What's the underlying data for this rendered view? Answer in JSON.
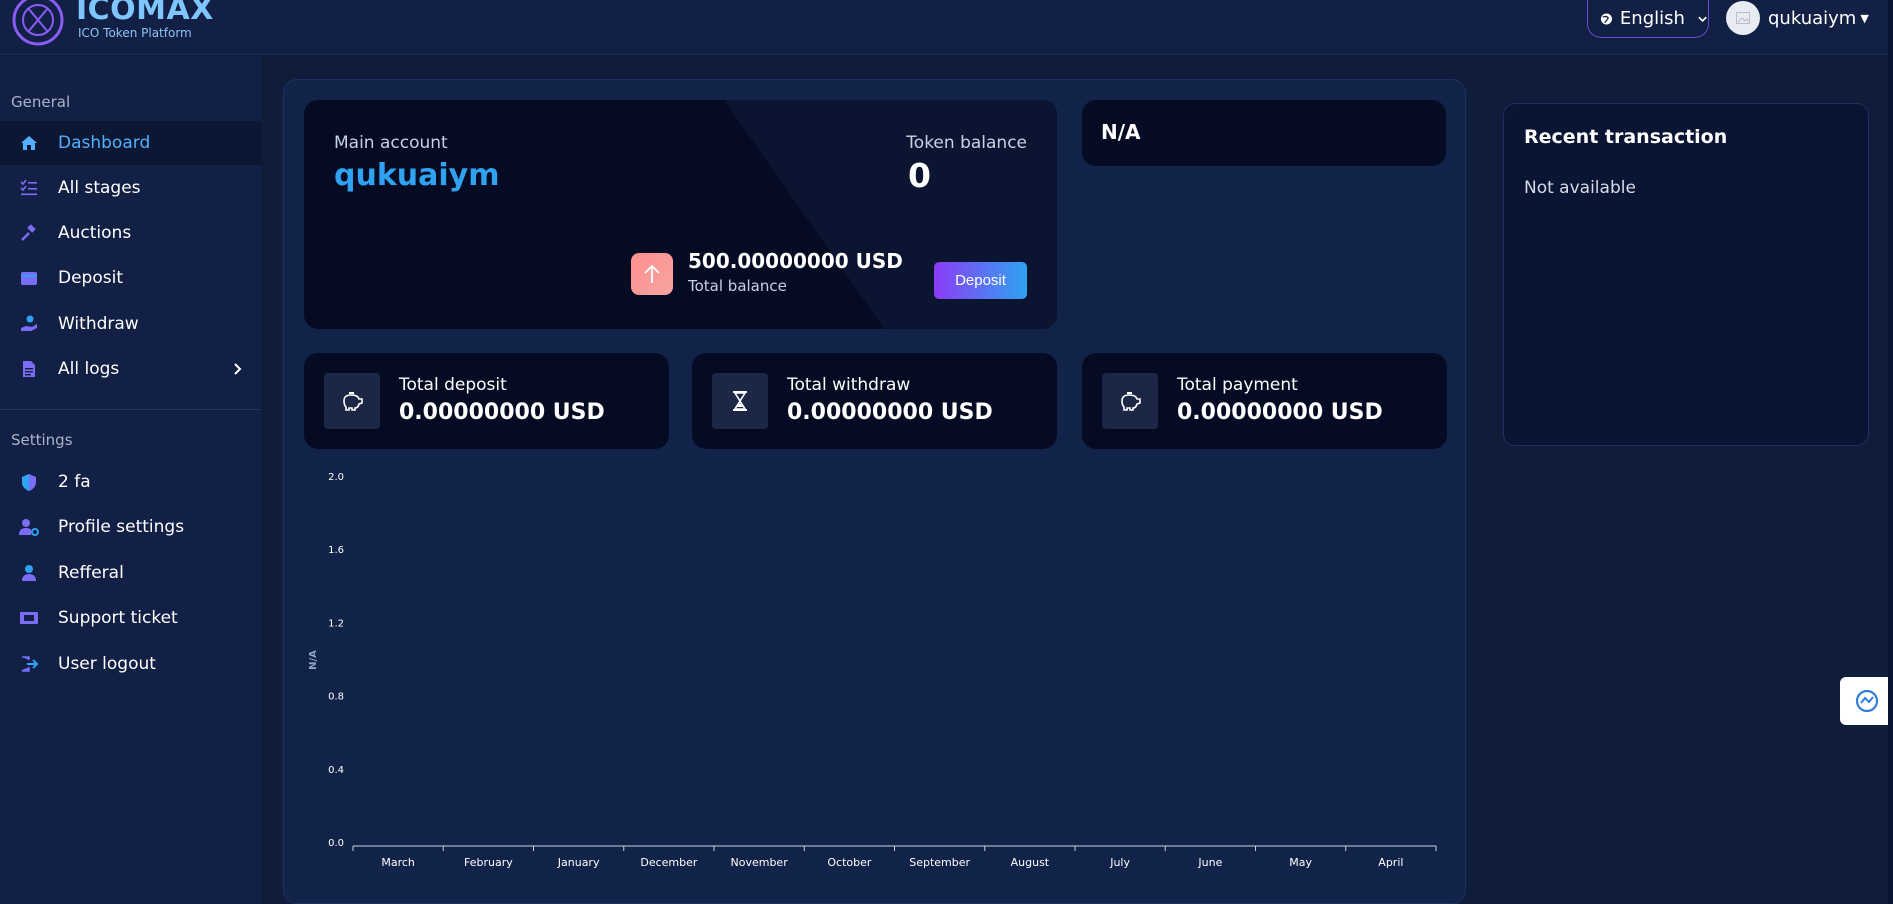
{
  "brand": {
    "name": "ICOMAX",
    "tagline": "ICO Token Platform"
  },
  "header": {
    "language": "English",
    "username": "qukuaiym"
  },
  "sidebar": {
    "general_label": "General",
    "settings_label": "Settings",
    "general_items": [
      {
        "label": "Dashboard",
        "icon": "home-icon",
        "active": true
      },
      {
        "label": "All stages",
        "icon": "list-icon"
      },
      {
        "label": "Auctions",
        "icon": "gavel-icon"
      },
      {
        "label": "Deposit",
        "icon": "wallet-icon"
      },
      {
        "label": "Withdraw",
        "icon": "hand-coin-icon"
      },
      {
        "label": "All logs",
        "icon": "document-icon"
      }
    ],
    "settings_items": [
      {
        "label": "2 fa",
        "icon": "shield-icon"
      },
      {
        "label": "Profile settings",
        "icon": "user-gear-icon"
      },
      {
        "label": "Refferal",
        "icon": "user-icon"
      },
      {
        "label": "Support ticket",
        "icon": "ticket-icon"
      },
      {
        "label": "User logout",
        "icon": "logout-icon"
      }
    ]
  },
  "account": {
    "main_label": "Main account",
    "username": "qukuaiym",
    "token_label": "Token balance",
    "token_value": "0",
    "total_amount": "500.00000000 USD",
    "total_label": "Total balance",
    "deposit_button": "Deposit"
  },
  "na_card": {
    "text": "N/A"
  },
  "stats": [
    {
      "label": "Total deposit",
      "value": "0.00000000 USD",
      "icon": "piggy-bank-icon"
    },
    {
      "label": "Total withdraw",
      "value": "0.00000000 USD",
      "icon": "hourglass-icon"
    },
    {
      "label": "Total payment",
      "value": "0.00000000 USD",
      "icon": "piggy-bank-icon"
    }
  ],
  "recent": {
    "title": "Recent transaction",
    "empty": "Not available"
  },
  "chart_data": {
    "type": "bar",
    "categories": [
      "March",
      "February",
      "January",
      "December",
      "November",
      "October",
      "September",
      "August",
      "July",
      "June",
      "May",
      "April"
    ],
    "values": [
      0,
      0,
      0,
      0,
      0,
      0,
      0,
      0,
      0,
      0,
      0,
      0
    ],
    "ylabel": "N/A",
    "ylim": [
      0,
      2.0
    ],
    "yticks": [
      "0.0",
      "0.4",
      "0.8",
      "1.2",
      "1.6",
      "2.0"
    ],
    "grid": false,
    "colors": {
      "axis": "#c8d0e0",
      "text": "#ffffff"
    }
  }
}
